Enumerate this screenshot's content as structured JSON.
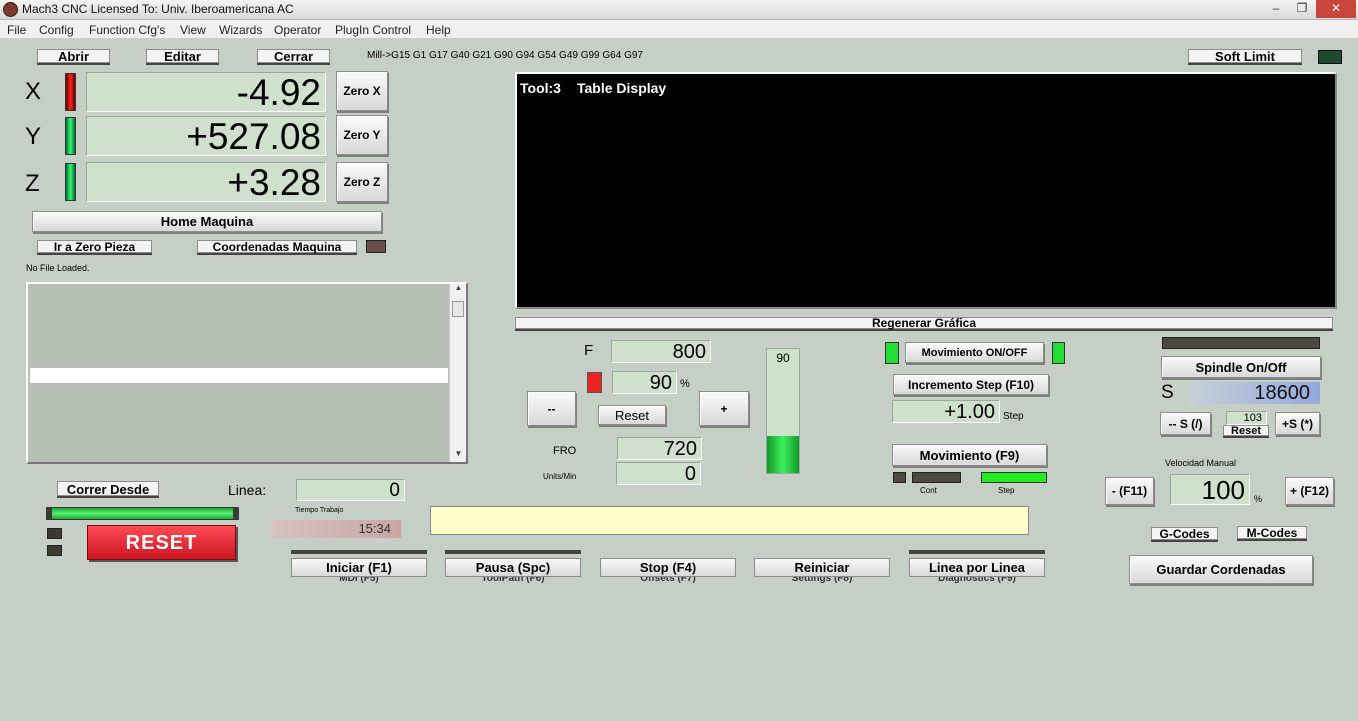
{
  "window": {
    "title": "Mach3 CNC  Licensed To: Univ. Iberoamericana AC",
    "minimize": "–",
    "restore": "❐",
    "close": "✕"
  },
  "menu": [
    "File",
    "Config",
    "Function Cfg's",
    "View",
    "Wizards",
    "Operator",
    "PlugIn Control",
    "Help"
  ],
  "file_buttons": {
    "open": "Abrir",
    "edit": "Editar",
    "close": "Cerrar"
  },
  "gcode_state": "Mill->G15  G1 G17 G40 G21 G90 G94 G54 G49 G99 G64 G97",
  "soft_limit": "Soft Limit",
  "axes": [
    {
      "label": "X",
      "value": "-4.92",
      "zero": "Zero X",
      "led": "red"
    },
    {
      "label": "Y",
      "value": "+527.08",
      "zero": "Zero Y",
      "led": "green"
    },
    {
      "label": "Z",
      "value": "+3.28",
      "zero": "Zero Z",
      "led": "green"
    }
  ],
  "home_machine": "Home Maquina",
  "goto_zero": "Ir a Zero Pieza",
  "machine_coords": "Coordenadas Maquina",
  "file_status": "No File Loaded.",
  "display": {
    "tool": "Tool:3",
    "title": "Table Display"
  },
  "regen": "Regenerar Gráfica",
  "feed": {
    "f_label": "F",
    "f_value": "800",
    "override_value": "90",
    "override_unit": "%",
    "minus": "--",
    "reset": "Reset",
    "plus": "+",
    "fro_label": "FRO",
    "fro_value": "720",
    "units_label": "Units/Min",
    "units_value": "0",
    "slider_value": "90"
  },
  "jog": {
    "movement_toggle": "Movimiento ON/OFF",
    "increment_step": "Incremento Step (F10)",
    "step_value": "+1.00",
    "step_label": "Step",
    "movement": "Movimiento (F9)",
    "cont_label": "Cont",
    "step_mode_label": "Step"
  },
  "spindle": {
    "toggle": "Spindle On/Off",
    "s_label": "S",
    "s_value": "18600",
    "minus": "-- S (/)",
    "override": "103",
    "reset": "Reset",
    "plus": "+S (*)"
  },
  "manual_speed": {
    "label": "Velocidad Manual",
    "minus": "- (F11)",
    "value": "100",
    "unit": "%",
    "plus": "+ (F12)"
  },
  "codes": {
    "g": "G-Codes",
    "m": "M-Codes"
  },
  "save_coords": "Guardar Cordenadas",
  "run_from": "Correr Desde",
  "line_label": "Linea:",
  "line_value": "0",
  "work_time_label": "Tiempo Trabajo",
  "work_time": "15:34",
  "reset": "RESET",
  "bottom_buttons": [
    {
      "label": "Iniciar (F1)",
      "under": "MDI (F5)"
    },
    {
      "label": "Pausa (Spc)",
      "under": "ToolPath (F6)"
    },
    {
      "label": "Stop (F4)",
      "under": "Offsets (F7)"
    },
    {
      "label": "Reiniciar",
      "under": "Settings (F8)"
    },
    {
      "label": "Linea por Linea",
      "under": "Diagnostics (F9)"
    }
  ],
  "colors": {
    "bg": "#c6cfc5",
    "field": "#cfe0cc",
    "led_green": "#22dd33",
    "led_red": "#ee2222",
    "reset_red": "#dd1f2b"
  }
}
